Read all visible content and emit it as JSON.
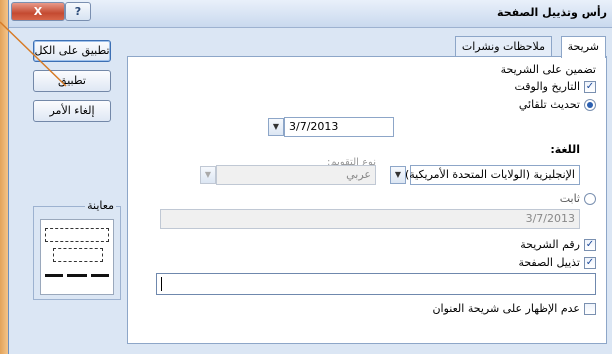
{
  "window": {
    "title": "رأس وتذييل الصفحة",
    "close_label": "X",
    "help_label": "?"
  },
  "tabs": [
    {
      "label": "شريحة",
      "active": true
    },
    {
      "label": "ملاحظات ونشرات",
      "active": false
    }
  ],
  "slide": {
    "group_title": "تضمين على الشريحة",
    "date_time": {
      "label": "التاريخ والوقت",
      "checked": true
    },
    "auto_update": {
      "label": "تحديث تلقائي",
      "selected": true
    },
    "date_value": "3/7/2013",
    "language_label": "اللغة:",
    "language_value": "الإنجليزية (الولايات المتحدة الأمريكية)",
    "calendar_label": "نوع التقويم:",
    "calendar_value": "عربي",
    "fixed": {
      "label": "ثابت",
      "selected": false
    },
    "fixed_value": "3/7/2013",
    "slide_number": {
      "label": "رقم الشريحة",
      "checked": true
    },
    "footer": {
      "label": "تذييل الصفحة",
      "checked": true,
      "value": ""
    },
    "dont_show_title": {
      "label": "عدم الإظهار على شريحة العنوان",
      "checked": false
    }
  },
  "buttons": {
    "apply_all": "تطبيق على الكل",
    "apply": "تطبيق",
    "cancel": "إلغاء الأمر"
  },
  "preview_label": "معاينة",
  "colors": {
    "dialog_bg": "#dbe6f4",
    "frame_orange": "#f4c48a",
    "pointer_line": "#d77b26"
  }
}
